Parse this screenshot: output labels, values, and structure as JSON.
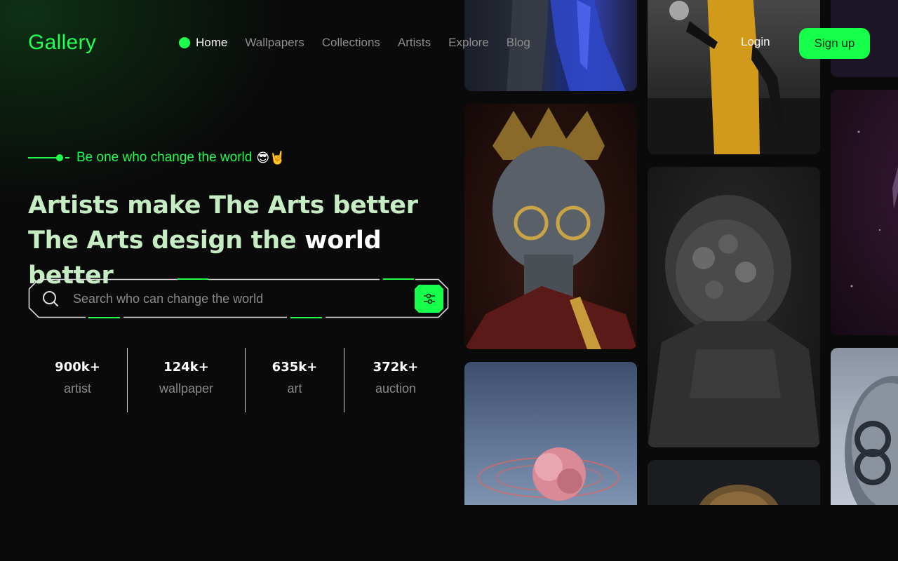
{
  "header": {
    "logo": "Gallery",
    "nav": [
      {
        "label": "Home",
        "active": true
      },
      {
        "label": "Wallpapers",
        "active": false
      },
      {
        "label": "Collections",
        "active": false
      },
      {
        "label": "Artists",
        "active": false
      },
      {
        "label": "Explore",
        "active": false
      },
      {
        "label": "Blog",
        "active": false
      }
    ],
    "login_label": "Login",
    "signup_label": "Sign up"
  },
  "hero": {
    "tagline": "Be one who change the world",
    "tagline_emoji": "😎🤘",
    "headline_line1": "Artists make The Arts better",
    "headline_line2_a": "The Arts design the",
    "headline_line2_highlight": "world",
    "headline_line2_b": "better"
  },
  "search": {
    "placeholder": "Search who can change the world",
    "value": ""
  },
  "stats": [
    {
      "value": "900k+",
      "label": "artist"
    },
    {
      "value": "124k+",
      "label": "wallpaper"
    },
    {
      "value": "635k+",
      "label": "art"
    },
    {
      "value": "372k+",
      "label": "auction"
    }
  ],
  "gallery": {
    "images": [
      "blue-split-face-sculpture",
      "crowned-statue-with-glasses",
      "pink-flower-planet-rings",
      "figure-in-yellow-robe",
      "astronaut-with-flower-helmet",
      "ornate-bronze-helmet",
      "purple-abstract",
      "purple-figure",
      "chrome-head-with-goggles"
    ]
  },
  "colors": {
    "accent": "#1cff4d",
    "headline": "#c5ecc3",
    "background": "#0a0a0a"
  }
}
